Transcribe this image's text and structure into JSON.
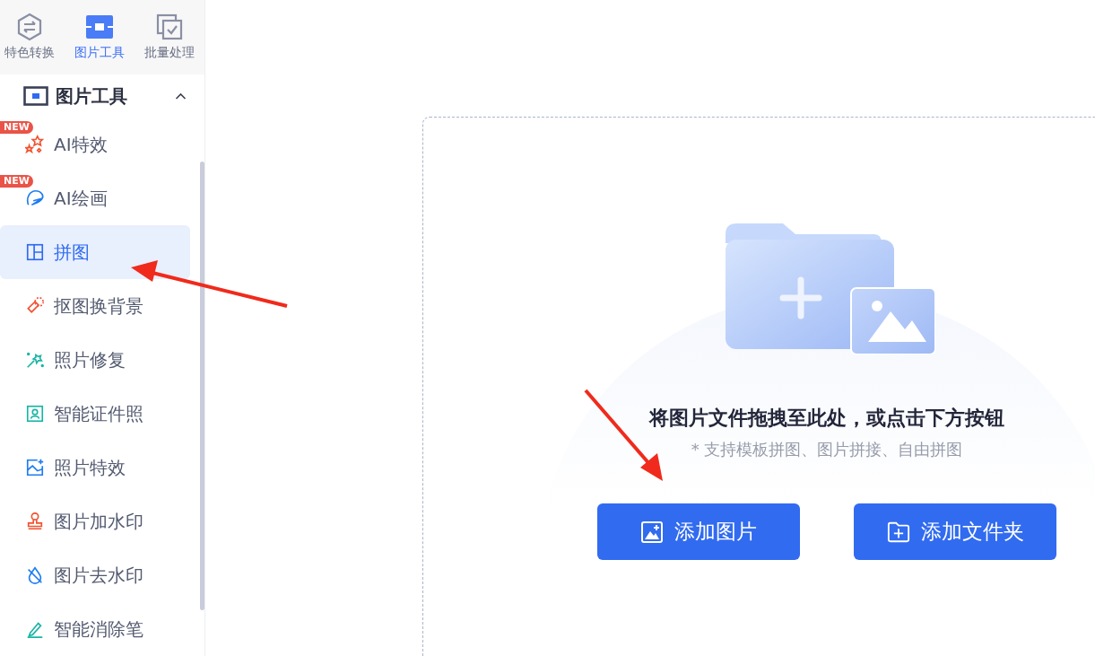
{
  "top_tabs": [
    {
      "label": "特色转换",
      "kind": "convert",
      "selected": false
    },
    {
      "label": "图片工具",
      "kind": "toolbox",
      "selected": true
    },
    {
      "label": "批量处理",
      "kind": "batch",
      "selected": false
    }
  ],
  "section": {
    "title": "图片工具",
    "expanded": true
  },
  "items": [
    {
      "label": "AI特效",
      "kind": "stars",
      "badge": "NEW",
      "selected": false
    },
    {
      "label": "AI绘画",
      "kind": "paint",
      "badge": "NEW",
      "selected": false
    },
    {
      "label": "拼图",
      "kind": "collage",
      "selected": true
    },
    {
      "label": "抠图换背景",
      "kind": "cutout",
      "selected": false
    },
    {
      "label": "照片修复",
      "kind": "wand",
      "selected": false
    },
    {
      "label": "智能证件照",
      "kind": "portrait",
      "selected": false
    },
    {
      "label": "照片特效",
      "kind": "photo",
      "selected": false
    },
    {
      "label": "图片加水印",
      "kind": "stamp",
      "selected": false
    },
    {
      "label": "图片去水印",
      "kind": "drop",
      "selected": false
    },
    {
      "label": "智能消除笔",
      "kind": "pen",
      "selected": false
    }
  ],
  "drop_zone": {
    "title": "将图片文件拖拽至此处，或点击下方按钮",
    "hint": "* 支持模板拼图、图片拼接、自由拼图",
    "buttons": [
      {
        "label": "添加图片",
        "kind": "image"
      },
      {
        "label": "添加文件夹",
        "kind": "folder"
      }
    ]
  }
}
